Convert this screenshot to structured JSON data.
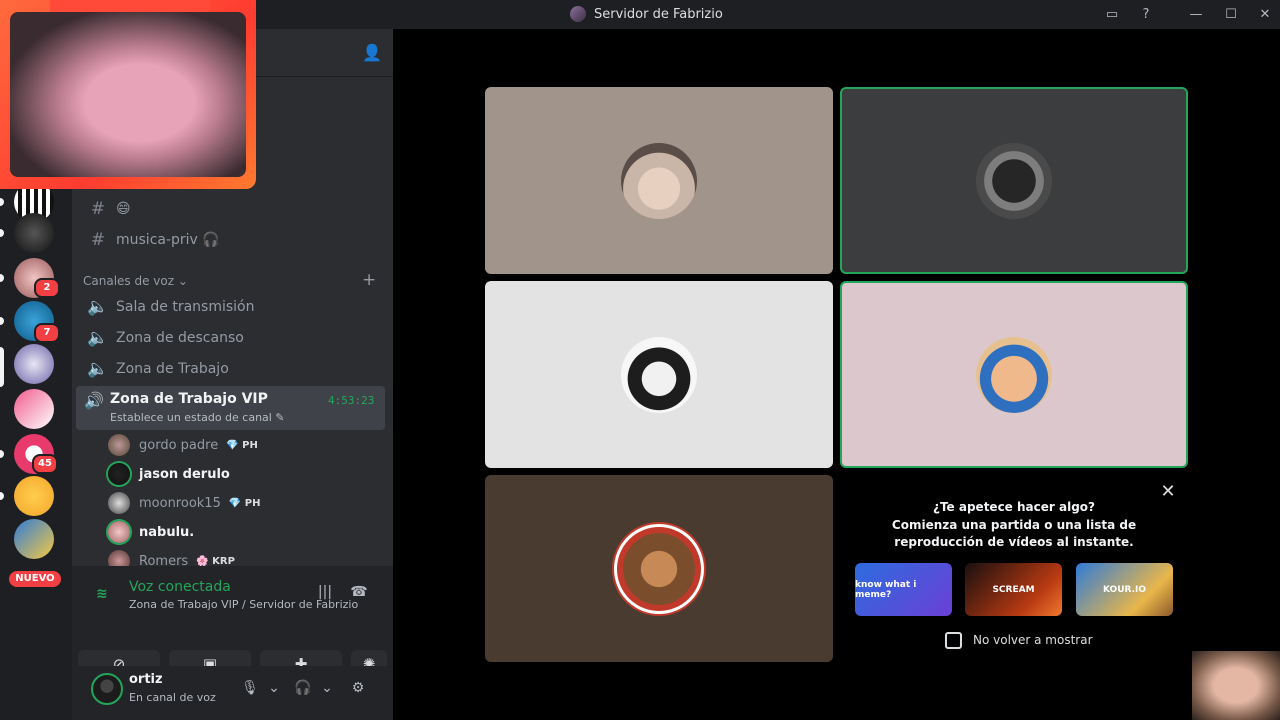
{
  "window": {
    "title": "Servidor de Fabrizio",
    "controls": {
      "inbox": "▭",
      "help": "?",
      "minimize": "—",
      "maximize": "☐",
      "close": "✕"
    }
  },
  "server_rail": {
    "badges": [
      "2",
      "7",
      "45"
    ],
    "new_label": "NUEVO"
  },
  "sidebar": {
    "text_channels": [
      {
        "name": "",
        "emoji": "😄"
      },
      {
        "name": "musica-priv 🎧"
      }
    ],
    "voice_category": "Canales de voz ⌄",
    "voice_channels": [
      "Sala de transmisión",
      "Zona de descanso",
      "Zona de Trabajo"
    ],
    "active_channel": {
      "name": "Zona de Trabajo VIP",
      "status": "Establece un estado de canal ✎",
      "timer": "4:53:23"
    },
    "members": [
      {
        "name": "gordo padre",
        "tag": "💎 PH",
        "speaking": false
      },
      {
        "name": "jason derulo",
        "tag": "",
        "speaking": true
      },
      {
        "name": "moonrook15",
        "tag": "💎 PH",
        "speaking": false
      },
      {
        "name": "nabulu.",
        "tag": "",
        "speaking": true
      },
      {
        "name": "Romers",
        "tag": "🌸 KRP",
        "speaking": false
      }
    ]
  },
  "voice_panel": {
    "title": "Voz conectada",
    "subtitle": "Zona de Trabajo VIP / Servidor de Fabrizio"
  },
  "user_panel": {
    "name": "ortiz",
    "status": "En canal de voz"
  },
  "activity_card": {
    "title": "¿Te apetece hacer algo?",
    "subtitle": "Comienza una partida o una lista de reproducción de vídeos al instante.",
    "games": [
      "know what i meme?",
      "SCREAM",
      "KOUR.IO"
    ],
    "checkbox_label": "No volver a mostrar"
  },
  "colors": {
    "speaking": "#23a55a",
    "accent_red": "#f23f43"
  }
}
